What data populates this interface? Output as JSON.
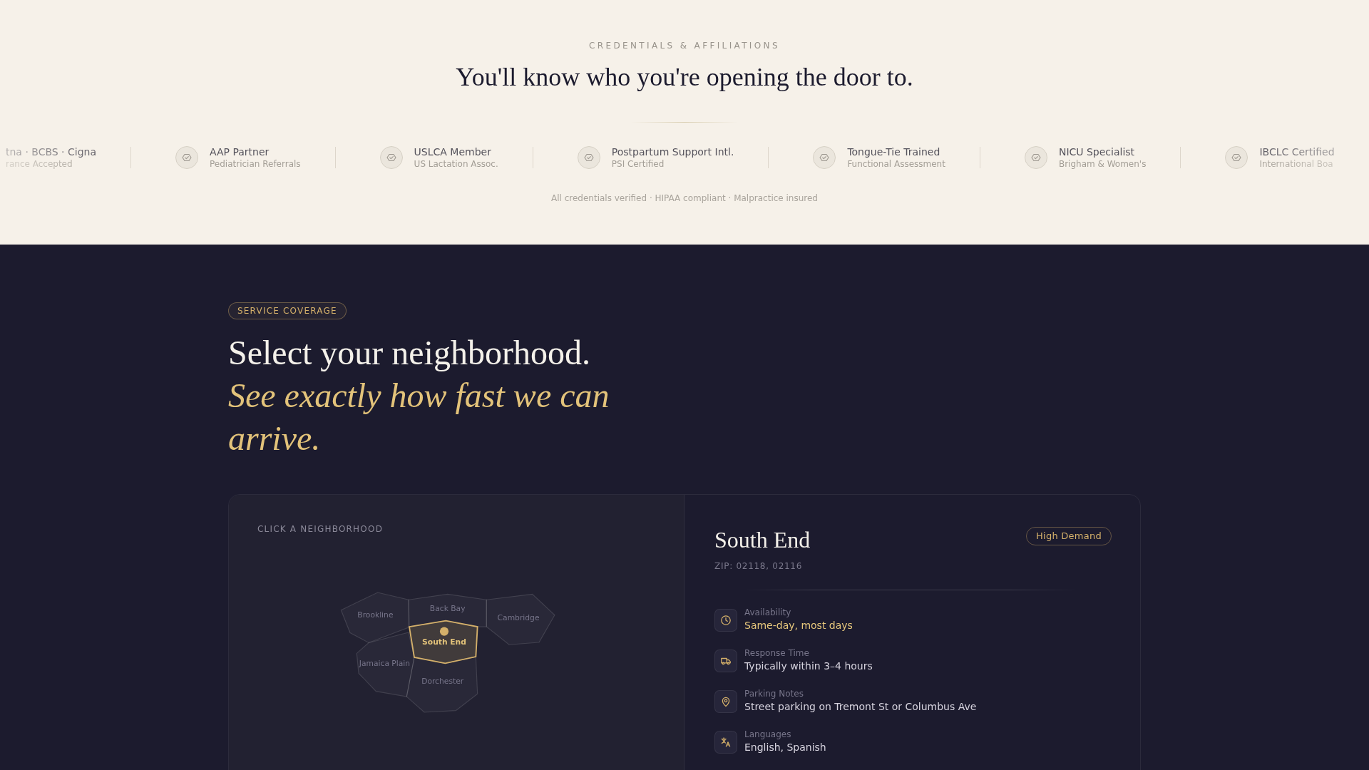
{
  "credentials": {
    "eyebrow": "CREDENTIALS & AFFILIATIONS",
    "title": "You'll know who you're opening the door to.",
    "items": [
      {
        "kind": "cut",
        "name": "tna · BCBS · Cigna",
        "detail": "rance Accepted"
      },
      {
        "kind": "badge",
        "name": "AAP Partner",
        "detail": "Pediatrician Referrals"
      },
      {
        "kind": "badge",
        "name": "USLCA Member",
        "detail": "US Lactation Assoc."
      },
      {
        "kind": "badge",
        "name": "Postpartum Support Intl.",
        "detail": "PSI Certified"
      },
      {
        "kind": "badge",
        "name": "Tongue-Tie Trained",
        "detail": "Functional Assessment"
      },
      {
        "kind": "badge",
        "name": "NICU Specialist",
        "detail": "Brigham & Women's"
      },
      {
        "kind": "badge",
        "name": "IBCLC Certified",
        "detail": "International Boa"
      }
    ],
    "footnote": "All credentials verified · HIPAA compliant · Malpractice insured"
  },
  "coverage": {
    "tag": "SERVICE COVERAGE",
    "title": "Select your neighborhood.",
    "title_accent": "See exactly how fast we can arrive.",
    "map": {
      "label": "CLICK A NEIGHBORHOOD",
      "regions": [
        {
          "name": "Brookline",
          "selected": false
        },
        {
          "name": "Back Bay",
          "selected": false
        },
        {
          "name": "Cambridge",
          "selected": false
        },
        {
          "name": "South End",
          "selected": true
        },
        {
          "name": "Jamaica Plain",
          "selected": false
        },
        {
          "name": "Dorchester",
          "selected": false
        }
      ]
    },
    "details": {
      "title": "South End",
      "badge": "High Demand",
      "zip": "ZIP: 02118, 02116",
      "facts": [
        {
          "label": "Availability",
          "value": "Same-day, most days",
          "highlighted": true
        },
        {
          "label": "Response Time",
          "value": "Typically within 3–4 hours",
          "highlighted": false
        },
        {
          "label": "Parking Notes",
          "value": "Street parking on Tremont St or Columbus Ave",
          "highlighted": false
        },
        {
          "label": "Languages",
          "value": "English, Spanish",
          "highlighted": false
        }
      ]
    }
  }
}
